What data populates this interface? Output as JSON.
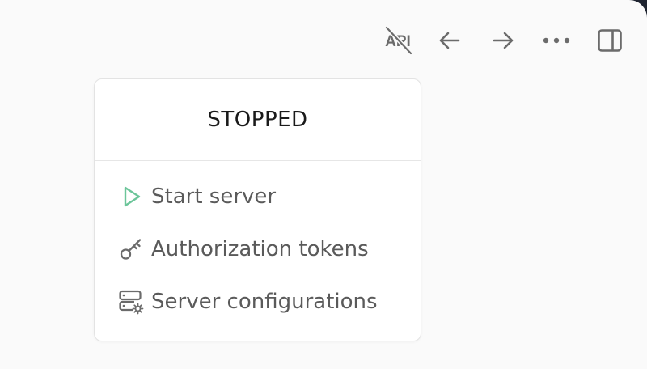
{
  "toolbar": {
    "api_label": "API",
    "icons": [
      "api-disabled-icon",
      "arrow-left-icon",
      "arrow-right-icon",
      "more-horizontal-icon",
      "sidebar-panel-icon"
    ]
  },
  "server_menu": {
    "status": "STOPPED",
    "items": [
      {
        "label": "Start server",
        "icon": "play-icon",
        "icon_color": "#6cc59a"
      },
      {
        "label": "Authorization tokens",
        "icon": "key-icon",
        "icon_color": "#6b6b6b"
      },
      {
        "label": "Server configurations",
        "icon": "server-settings-icon",
        "icon_color": "#6b6b6b"
      }
    ]
  },
  "colors": {
    "background": "#fafafa",
    "icon_gray": "#6b6b6b",
    "accent_green": "#6cc59a",
    "text_dark": "#1a1a1a",
    "text_gray": "#5a5a5a"
  }
}
